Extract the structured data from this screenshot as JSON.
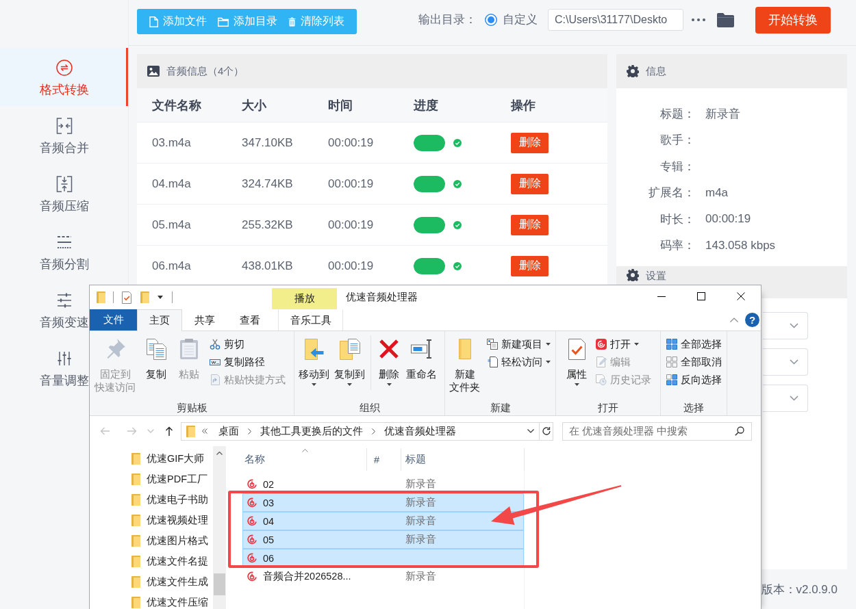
{
  "sidebar": {
    "items": [
      {
        "label": "格式转换",
        "kind": "convert",
        "selected": true
      },
      {
        "label": "音频合并",
        "kind": "merge",
        "selected": false
      },
      {
        "label": "音频压缩",
        "kind": "compress",
        "selected": false
      },
      {
        "label": "音频分割",
        "kind": "split",
        "selected": false
      },
      {
        "label": "音频变速",
        "kind": "speed",
        "selected": false
      },
      {
        "label": "音量调整",
        "kind": "volume",
        "selected": false
      }
    ]
  },
  "toolbar": {
    "buttons": [
      {
        "label": "添加文件",
        "kind": "file"
      },
      {
        "label": "添加目录",
        "kind": "folder"
      },
      {
        "label": "清除列表",
        "kind": "clear"
      }
    ]
  },
  "output": {
    "label": "输出目录：",
    "option": {
      "label": "自定义",
      "selected": true
    },
    "path": "C:\\Users\\31177\\Deskto"
  },
  "start_button": "开始转换",
  "file_panel": {
    "title": "音频信息（4个）",
    "columns": [
      "文件名称",
      "大小",
      "时间",
      "进度",
      "操作"
    ],
    "rows": [
      {
        "name": "03.m4a",
        "size": "347.10KB",
        "time": "00:00:19",
        "level": 1,
        "done": true,
        "action": "删除"
      },
      {
        "name": "04.m4a",
        "size": "324.74KB",
        "time": "00:00:19",
        "level": 1,
        "done": true,
        "action": "删除"
      },
      {
        "name": "05.m4a",
        "size": "255.32KB",
        "time": "00:00:19",
        "level": 1,
        "done": true,
        "action": "删除"
      },
      {
        "name": "06.m4a",
        "size": "438.01KB",
        "time": "00:00:19",
        "level": 1,
        "done": true,
        "action": "删除"
      }
    ]
  },
  "info_panel": {
    "title": "信息",
    "fields": [
      {
        "label": "标题：",
        "value": "新录音"
      },
      {
        "label": "歌手："
      },
      {
        "label": "专辑："
      },
      {
        "label": "扩展名：",
        "value": "m4a"
      },
      {
        "label": "时长：",
        "value": "00:00:19"
      },
      {
        "label": "码率：",
        "value": "143.058 kbps"
      }
    ]
  },
  "settings_panel": {
    "title": "设置",
    "dropdowns": [
      {
        "expanded": false
      },
      {
        "expanded": false
      },
      {
        "expanded": false
      }
    ]
  },
  "version": "版本：v2.0.9.0",
  "explorer": {
    "title": "优速音频处理器",
    "context_header": "播放",
    "tabs": [
      {
        "label": "文件",
        "kind": "backstage",
        "selected": false
      },
      {
        "label": "主页",
        "kind": "tab",
        "selected": true
      },
      {
        "label": "共享",
        "kind": "tab",
        "selected": false
      },
      {
        "label": "查看",
        "kind": "tab",
        "selected": false
      },
      {
        "label": "音乐工具",
        "kind": "context",
        "selected": false
      }
    ],
    "help": "?",
    "ribbon": [
      {
        "label": "剪贴板",
        "sections": [
          {
            "kind": "large",
            "buttons": [
              {
                "kind": "pin",
                "lines": [
                  "固定到",
                  "快速访问"
                ],
                "disabled": true,
                "dropdown": false
              },
              {
                "kind": "copy",
                "label": "复制",
                "disabled": false,
                "dropdown": false
              },
              {
                "kind": "paste",
                "label": "粘贴",
                "disabled": true,
                "dropdown": false
              }
            ]
          },
          {
            "kind": "small",
            "buttons": [
              {
                "kind": "cut",
                "label": "剪切",
                "disabled": false,
                "dropdown": false
              },
              {
                "kind": "copy-path",
                "label": "复制路径",
                "disabled": false,
                "dropdown": false
              },
              {
                "kind": "paste-shortcut",
                "label": "粘贴快捷方式",
                "disabled": true,
                "dropdown": false
              }
            ]
          }
        ]
      },
      {
        "label": "组织",
        "sections": [
          {
            "kind": "large",
            "buttons": [
              {
                "kind": "move-to",
                "label": "移动到",
                "disabled": false,
                "dropdown": true
              },
              {
                "kind": "copy-to",
                "label": "复制到",
                "disabled": false,
                "dropdown": true
              }
            ]
          },
          {
            "kind": "large",
            "buttons": [
              {
                "kind": "delete",
                "label": "删除",
                "disabled": false,
                "dropdown": true
              },
              {
                "kind": "rename",
                "label": "重命名",
                "disabled": false,
                "dropdown": false
              }
            ]
          }
        ]
      },
      {
        "label": "新建",
        "sections": [
          {
            "kind": "large",
            "buttons": [
              {
                "kind": "new-folder",
                "lines": [
                  "新建",
                  "文件夹"
                ],
                "disabled": false,
                "dropdown": false
              }
            ]
          },
          {
            "kind": "small",
            "buttons": [
              {
                "kind": "new-item",
                "label": "新建项目",
                "disabled": false,
                "dropdown": true
              },
              {
                "kind": "easy-access",
                "label": "轻松访问",
                "disabled": false,
                "dropdown": true
              }
            ]
          }
        ]
      },
      {
        "label": "打开",
        "sections": [
          {
            "kind": "large",
            "buttons": [
              {
                "kind": "properties",
                "label": "属性",
                "disabled": false,
                "dropdown": true
              }
            ]
          },
          {
            "kind": "small",
            "buttons": [
              {
                "kind": "open",
                "label": "打开",
                "disabled": false,
                "dropdown": true
              },
              {
                "kind": "edit",
                "label": "编辑",
                "disabled": true,
                "dropdown": false
              },
              {
                "kind": "history",
                "label": "历史记录",
                "disabled": true,
                "dropdown": false
              }
            ]
          }
        ]
      },
      {
        "label": "选择",
        "sections": [
          {
            "kind": "small",
            "buttons": [
              {
                "kind": "select-all",
                "label": "全部选择",
                "disabled": false,
                "dropdown": false
              },
              {
                "kind": "select-none",
                "label": "全部取消",
                "disabled": false,
                "dropdown": false
              },
              {
                "kind": "invert-selection",
                "label": "反向选择",
                "disabled": false,
                "dropdown": false
              }
            ]
          }
        ]
      }
    ],
    "nav_buttons": [
      {
        "kind": "back",
        "disabled": true
      },
      {
        "kind": "forward",
        "disabled": true
      },
      {
        "kind": "recent",
        "disabled": true
      },
      {
        "kind": "up",
        "disabled": false
      }
    ],
    "address": {
      "crumbs": [
        "桌面",
        "其他工具更换后的文件",
        "优速音频处理器"
      ]
    },
    "search": {
      "placeholder": "在 优速音频处理器 中搜索"
    },
    "nav_pane": {
      "items": [
        {
          "label": "优速GIF大师",
          "selected": false
        },
        {
          "label": "优速PDF工厂",
          "selected": false
        },
        {
          "label": "优速电子书助",
          "selected": false
        },
        {
          "label": "优速视频处理",
          "selected": false
        },
        {
          "label": "优速图片格式",
          "selected": false
        },
        {
          "label": "优速文件名提",
          "selected": false
        },
        {
          "label": "优速文件生成",
          "selected": false
        },
        {
          "label": "优速文件压缩",
          "selected": false
        }
      ]
    },
    "columns": [
      {
        "label": "名称",
        "sorted": true
      },
      {
        "label": "#",
        "sorted": false
      },
      {
        "label": "标题",
        "sorted": false
      }
    ],
    "files": [
      {
        "name": "02",
        "title": "新录音",
        "selected": false
      },
      {
        "name": "03",
        "title": "新录音",
        "selected": true
      },
      {
        "name": "04",
        "title": "新录音",
        "selected": true
      },
      {
        "name": "05",
        "title": "新录音",
        "selected": true
      },
      {
        "name": "06",
        "selected": true
      },
      {
        "name": "音频合并2026528...",
        "title": "新录音",
        "selected": false
      }
    ]
  }
}
